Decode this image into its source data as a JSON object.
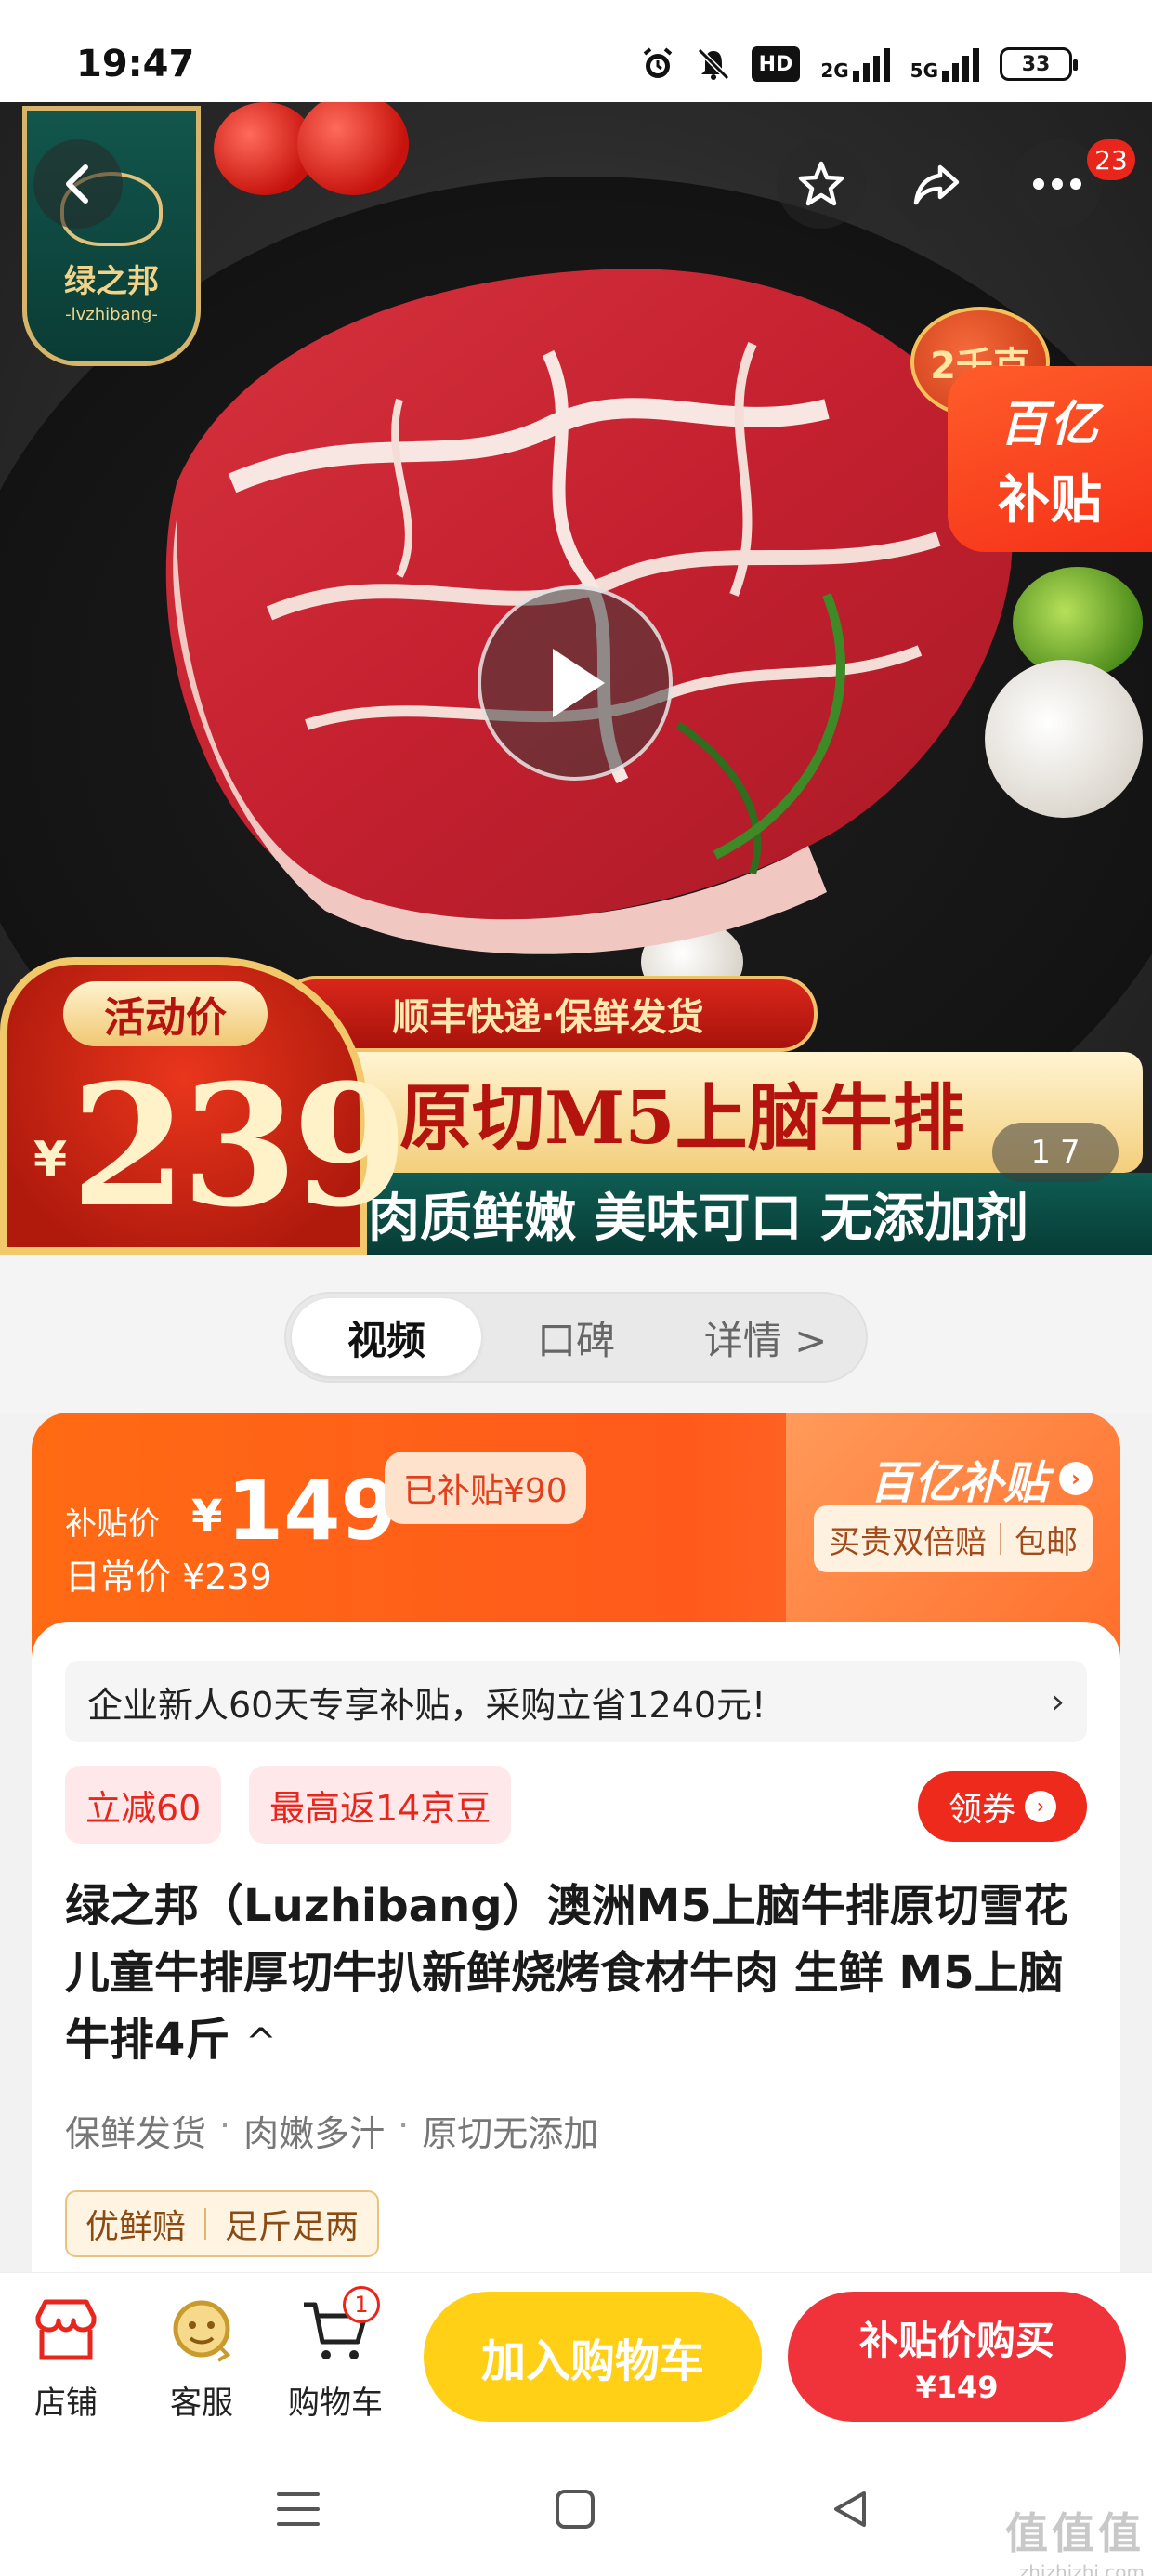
{
  "status_bar": {
    "time": "19:47",
    "network_2g": "2G",
    "network_5g": "5G",
    "hd_label": "HD",
    "battery": "33",
    "icons": [
      "alarm-icon",
      "mute-icon",
      "hd-icon",
      "signal-2g-icon",
      "signal-5g-icon",
      "battery-icon"
    ]
  },
  "hero": {
    "brand_cn": "绿之邦",
    "brand_en": "-lvzhibang-",
    "notification_count": "23",
    "subsidy_tag_line1": "百亿",
    "subsidy_tag_line2": "补贴",
    "corner_badge": "2千克",
    "shipping_banner": "顺丰快递·保鲜发货",
    "title_banner": "原切M5上脑牛排",
    "tagline": "肉质鲜嫩 美味可口 无添加剂",
    "price_label": "活动价",
    "price_currency": "¥",
    "price": "239",
    "image_index": "1",
    "image_total": "7"
  },
  "tabs": [
    {
      "label": "视频",
      "active": true
    },
    {
      "label": "口碑",
      "active": false
    },
    {
      "label": "详情 >",
      "active": false
    }
  ],
  "price_card": {
    "subsidy_label": "补贴价",
    "currency": "¥",
    "subsidy_price": "149",
    "saved": "已补贴¥90",
    "daily_price": "日常价 ¥239",
    "program_logo": "百亿补贴",
    "guarantee_1": "买贵双倍赔",
    "guarantee_2": "包邮"
  },
  "info_card": {
    "promo_text": "企业新人60天专享补贴，采购立省1240元!",
    "coupon_1": "立减60",
    "coupon_2": "最高返14京豆",
    "get_coupon": "领券",
    "product_title": "绿之邦（Luzhibang）澳洲M5上脑牛排原切雪花儿童牛排厚切牛扒新鲜烧烤食材牛肉 生鲜 M5上脑牛排4斤",
    "title_caret": "^",
    "features": [
      "保鲜发货",
      "肉嫩多汁",
      "原切无添加"
    ],
    "service_tag_1": "优鲜赔",
    "service_tag_2": "足斤足两"
  },
  "action_bar": {
    "store": "店铺",
    "service": "客服",
    "cart": "购物车",
    "cart_count": "1",
    "add_to_cart": "加入购物车",
    "buy_label": "补贴价购买",
    "buy_price": "¥149"
  },
  "watermark": {
    "line1": "值值值",
    "line2": "zhizhizhi.com"
  },
  "colors": {
    "accent_orange": "#ff5a1c",
    "accent_red": "#f0333a",
    "cart_yellow": "#ffd015",
    "brand_green": "#0f5d53"
  }
}
